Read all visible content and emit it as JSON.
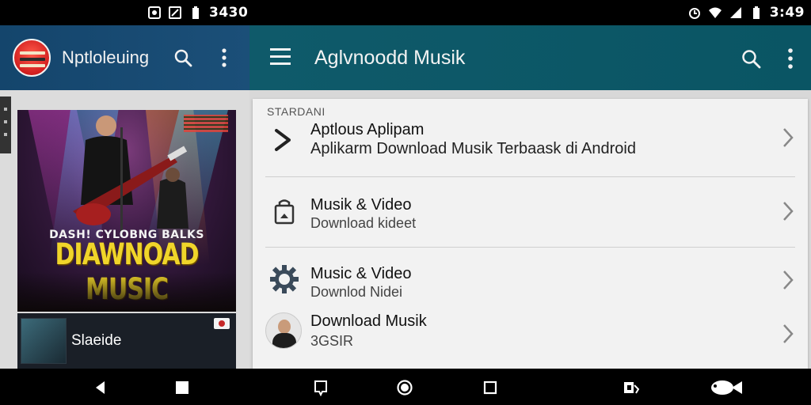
{
  "status_bar": {
    "left_time": "3430",
    "right_time": "3:49",
    "left_icons": [
      "alarm-icon",
      "notification-icon",
      "battery-icon"
    ],
    "right_icons": [
      "alarm-clock-icon",
      "wifi-icon",
      "signal-icon",
      "battery-icon"
    ]
  },
  "left_pane": {
    "title": "Nptloleuing",
    "logo": "app-logo",
    "poster": {
      "subtitle": "DASH! CYLOBNG BALKS",
      "headline": "DIAWNOAD MUSIC"
    },
    "thumb": {
      "label": "Slaeide"
    }
  },
  "right_pane": {
    "title": "Aglvnoodd Musik",
    "section_header": "STARDANI",
    "rows": [
      {
        "title": "Aptlous Aplipam",
        "subtitle": "Aplikarm Download Musik Terbaask di Android",
        "icon": "download-arrow-icon"
      },
      {
        "title": "Musik & Video",
        "subtitle": "Download kideet",
        "icon": "bag-icon"
      },
      {
        "title": "Music & Video",
        "subtitle": "Downlod Nidei",
        "icon": "gear-icon"
      },
      {
        "title": "Download Musik",
        "subtitle": "3GSIR",
        "icon": "avatar"
      }
    ]
  },
  "colors": {
    "left_appbar": "#14456c",
    "right_appbar": "#0f5a6a",
    "poster_headline": "#f0d52a",
    "card_bg": "#f2f2f2"
  },
  "nav_bar": {
    "icons": [
      "back-icon",
      "square-icon",
      "bookmark-icon",
      "home-icon",
      "recents-icon",
      "cast-icon",
      "fish-icon"
    ]
  }
}
